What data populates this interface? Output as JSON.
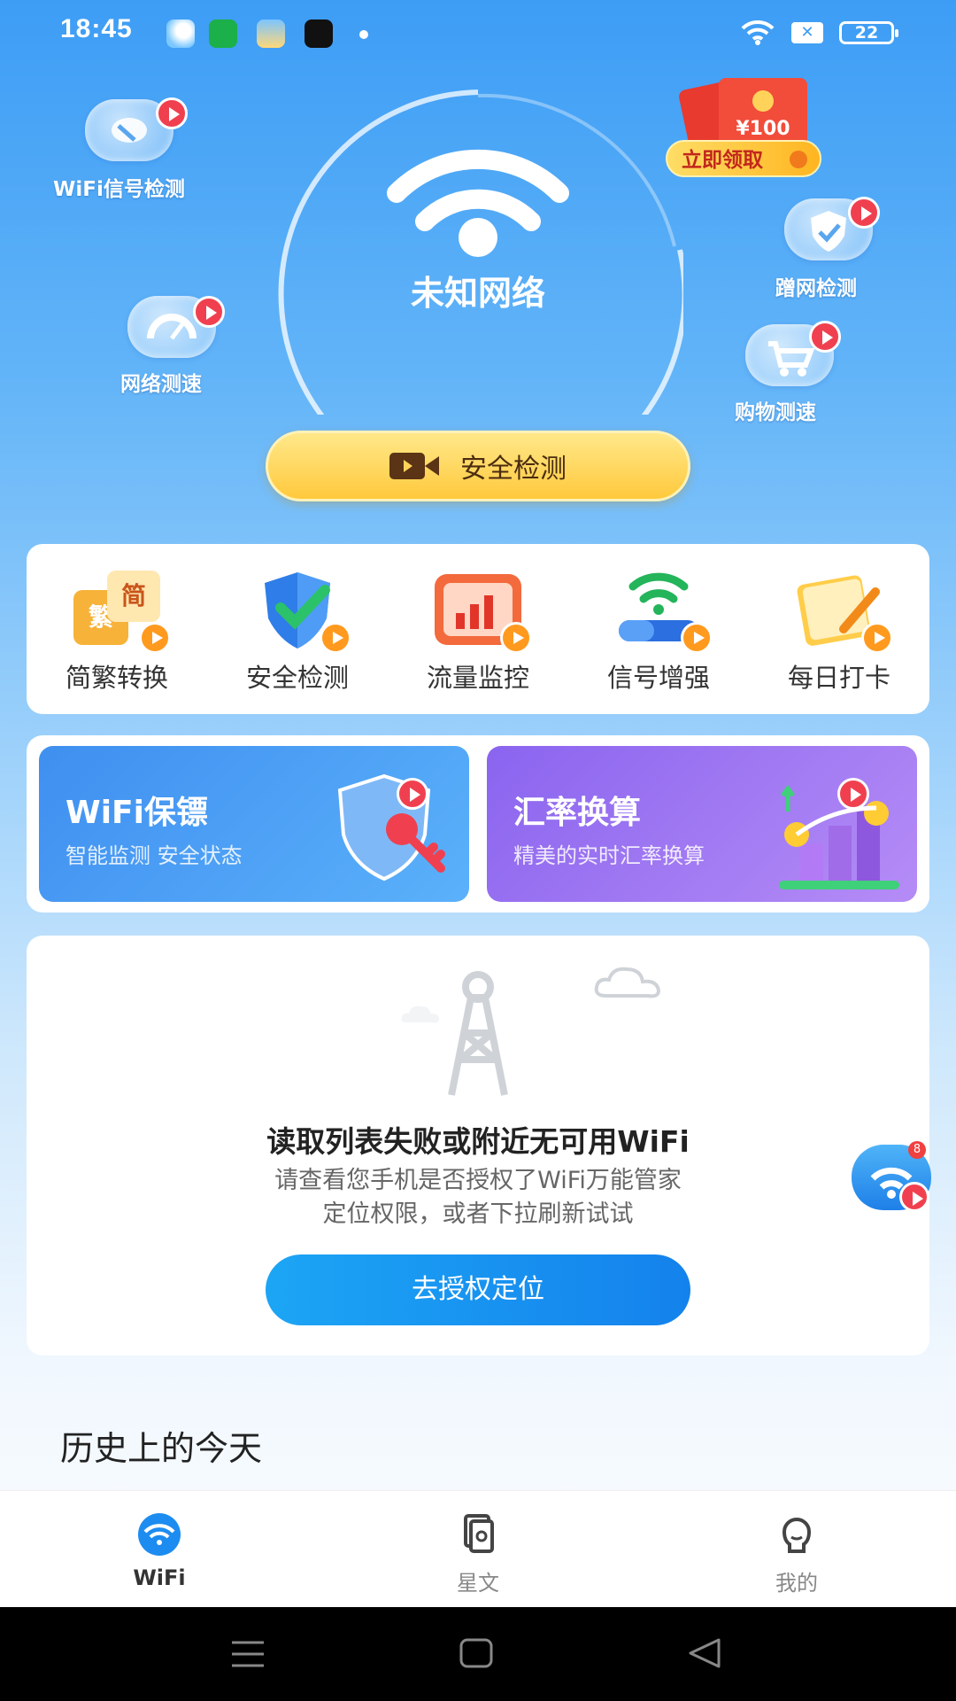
{
  "status_bar": {
    "time": "18:45",
    "battery": "22",
    "sim_label": "✕"
  },
  "hero": {
    "network_name": "未知网络",
    "security_button": "安全检测",
    "reward_amount": "¥100",
    "claim_button": "立即领取"
  },
  "floating_features": [
    {
      "label": "WiFi信号检测",
      "icon": "satellite-dish-icon"
    },
    {
      "label": "网络测速",
      "icon": "speedometer-icon"
    },
    {
      "label": "蹭网检测",
      "icon": "shield-check-icon"
    },
    {
      "label": "购物测速",
      "icon": "shopping-cart-icon"
    }
  ],
  "tools": [
    {
      "label": "简繁转换",
      "icon": "traditional-simplified-icon",
      "glyph_top": "简",
      "glyph_bottom": "繁"
    },
    {
      "label": "安全检测",
      "icon": "shield-icon"
    },
    {
      "label": "流量监控",
      "icon": "bar-chart-icon"
    },
    {
      "label": "信号增强",
      "icon": "signal-boost-icon"
    },
    {
      "label": "每日打卡",
      "icon": "notepad-icon"
    }
  ],
  "banners": [
    {
      "title": "WiFi保镖",
      "subtitle": "智能监测 安全状态",
      "color_from": "#3f8ff0",
      "color_to": "#5bb1fa"
    },
    {
      "title": "汇率换算",
      "subtitle": "精美的实时汇率换算",
      "color_from": "#8a64ef",
      "color_to": "#b58cf6"
    }
  ],
  "empty_state": {
    "heading": "读取列表失败或附近无可用WiFi",
    "desc_line1": "请查看您手机是否授权了WiFi万能管家",
    "desc_line2": "定位权限，或者下拉刷新试试",
    "button": "去授权定位"
  },
  "float_badge": "8",
  "history_title": "历史上的今天",
  "tabbar": [
    {
      "label": "WiFi",
      "icon": "wifi-icon",
      "active": true
    },
    {
      "label": "星文",
      "icon": "cards-icon",
      "active": false
    },
    {
      "label": "我的",
      "icon": "profile-icon",
      "active": false
    }
  ],
  "colors": {
    "accent": "#1482ec",
    "background_top": "#3d9df5",
    "cta_yellow": "#ffc93c"
  }
}
